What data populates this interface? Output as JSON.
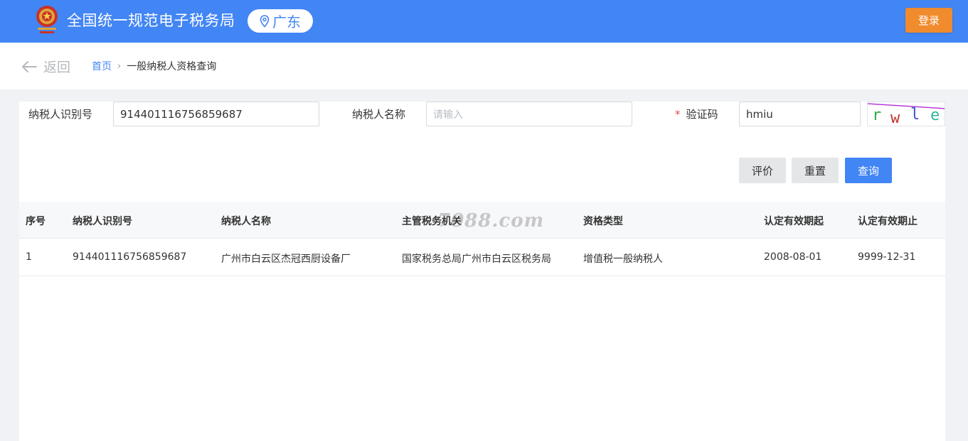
{
  "header": {
    "site_title": "全国统一规范电子税务局",
    "region": "广东",
    "login_label": "登录",
    "bar_color": "#4285f4",
    "login_color": "#f08b2e"
  },
  "nav": {
    "back_label": "返回",
    "breadcrumb": {
      "home": "首页",
      "separator": "›",
      "current": "一般纳税人资格查询"
    }
  },
  "form": {
    "taxpayer_id": {
      "label": "纳税人识别号",
      "value": "914401116756859687"
    },
    "taxpayer_name": {
      "label": "纳税人名称",
      "value": "",
      "placeholder": "请输入"
    },
    "captcha": {
      "required_mark": "*",
      "label": "验证码",
      "value": "hmiu",
      "image_text": "rwle"
    },
    "buttons": {
      "evaluate": "评价",
      "reset": "重置",
      "query": "查询"
    }
  },
  "table": {
    "columns": [
      "序号",
      "纳税人识别号",
      "纳税人名称",
      "主管税务机关",
      "资格类型",
      "认定有效期起",
      "认定有效期止"
    ],
    "rows": [
      [
        "1",
        "914401116756859687",
        "广州市白云区杰冠西厨设备厂",
        "国家税务总局广州市白云区税务局",
        "增值税一般纳税人",
        "2008-08-01",
        "9999-12-31"
      ]
    ]
  },
  "watermark": "7088.com"
}
